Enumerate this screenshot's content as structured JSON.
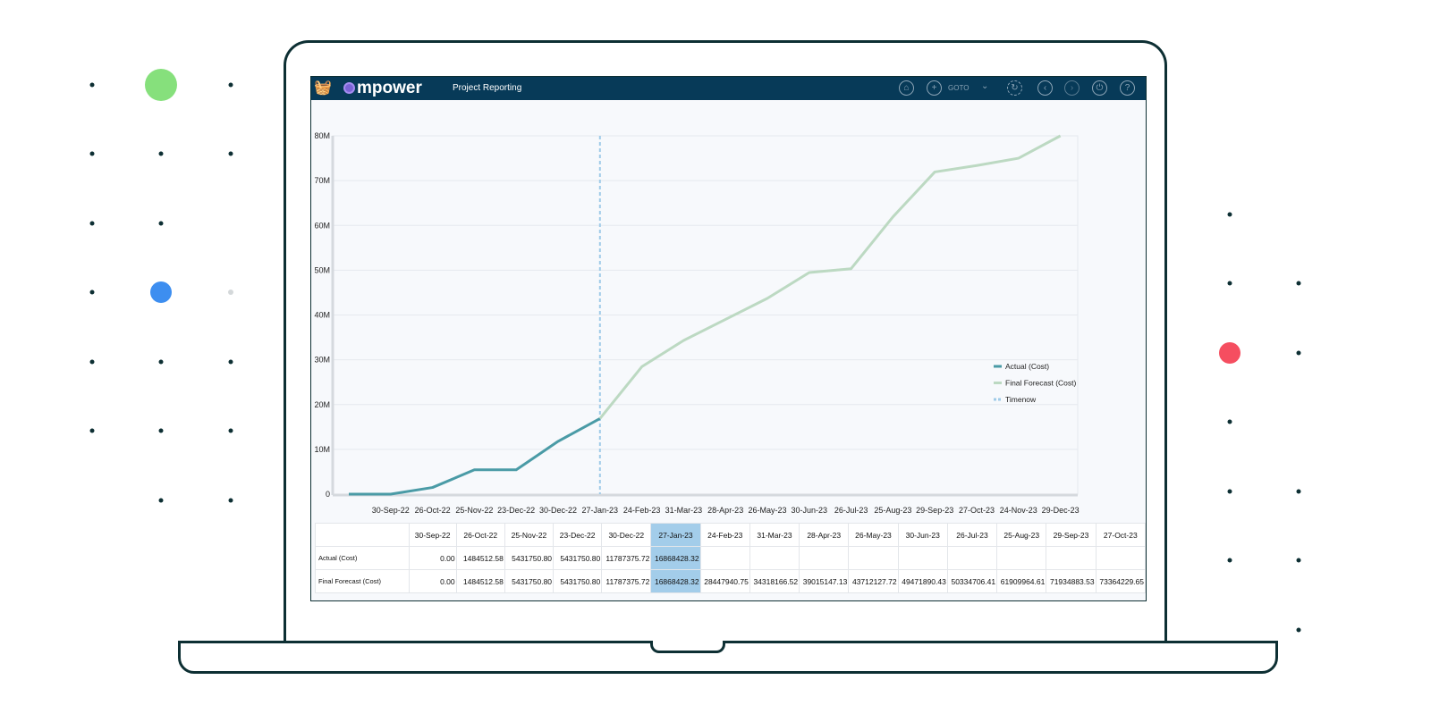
{
  "app": {
    "brand": "mpower",
    "title": "Project Reporting",
    "goto_label": "GOTO",
    "header_icons": [
      "basket-icon",
      "home-icon",
      "add-icon",
      "chevron-down-icon",
      "refresh-icon",
      "back-icon",
      "forward-icon",
      "power-icon",
      "help-icon"
    ]
  },
  "colors": {
    "header": "#073a58",
    "actual": "#4a9ba6",
    "forecast": "#bcd9c2",
    "timenow": "#9fcbe8",
    "green_dot": "#86e07c",
    "blue_dot": "#3d8ef0",
    "red_dot": "#f54e60"
  },
  "chart_data": {
    "type": "line",
    "categories": [
      "",
      "30-Sep-22",
      "26-Oct-22",
      "25-Nov-22",
      "23-Dec-22",
      "30-Dec-22",
      "27-Jan-23",
      "24-Feb-23",
      "31-Mar-23",
      "28-Apr-23",
      "26-May-23",
      "30-Jun-23",
      "26-Jul-23",
      "25-Aug-23",
      "29-Sep-23",
      "27-Oct-23",
      "24-Nov-23",
      "29-Dec-23"
    ],
    "yticks": [
      "0",
      "10M",
      "20M",
      "30M",
      "40M",
      "50M",
      "60M",
      "70M",
      "80M"
    ],
    "ylim": [
      0,
      80000000
    ],
    "grid": true,
    "legend_position": "right",
    "timenow_category": "27-Jan-23",
    "series": [
      {
        "name": "Actual (Cost)",
        "values": [
          0,
          0,
          1484512.58,
          5431750.8,
          5431750.8,
          11787375.72,
          16868428.32,
          null,
          null,
          null,
          null,
          null,
          null,
          null,
          null,
          null,
          null,
          null
        ]
      },
      {
        "name": "Final Forecast (Cost)",
        "values": [
          null,
          null,
          null,
          null,
          null,
          null,
          16868428.32,
          28447940.75,
          34318166.52,
          39015147.13,
          43712127.72,
          49471890.43,
          50334706.41,
          61909964.61,
          71934883.53,
          73364229.65,
          75000000,
          80000000
        ]
      }
    ],
    "timenow_label": "Timenow"
  },
  "table": {
    "columns": [
      "30-Sep-22",
      "26-Oct-22",
      "25-Nov-22",
      "23-Dec-22",
      "30-Dec-22",
      "27-Jan-23",
      "24-Feb-23",
      "31-Mar-23",
      "28-Apr-23",
      "26-May-23",
      "30-Jun-23",
      "26-Jul-23",
      "25-Aug-23",
      "29-Sep-23",
      "27-Oct-23"
    ],
    "highlight_column": "27-Jan-23",
    "rows": [
      {
        "label": "Actual (Cost)",
        "cells": [
          "0.00",
          "1484512.58",
          "5431750.80",
          "5431750.80",
          "11787375.72",
          "16868428.32",
          "",
          "",
          "",
          "",
          "",
          "",
          "",
          "",
          ""
        ]
      },
      {
        "label": "Final Forecast (Cost)",
        "cells": [
          "0.00",
          "1484512.58",
          "5431750.80",
          "5431750.80",
          "11787375.72",
          "16868428.32",
          "28447940.75",
          "34318166.52",
          "39015147.13",
          "43712127.72",
          "49471890.43",
          "50334706.41",
          "61909964.61",
          "71934883.53",
          "73364229.65"
        ]
      }
    ]
  }
}
